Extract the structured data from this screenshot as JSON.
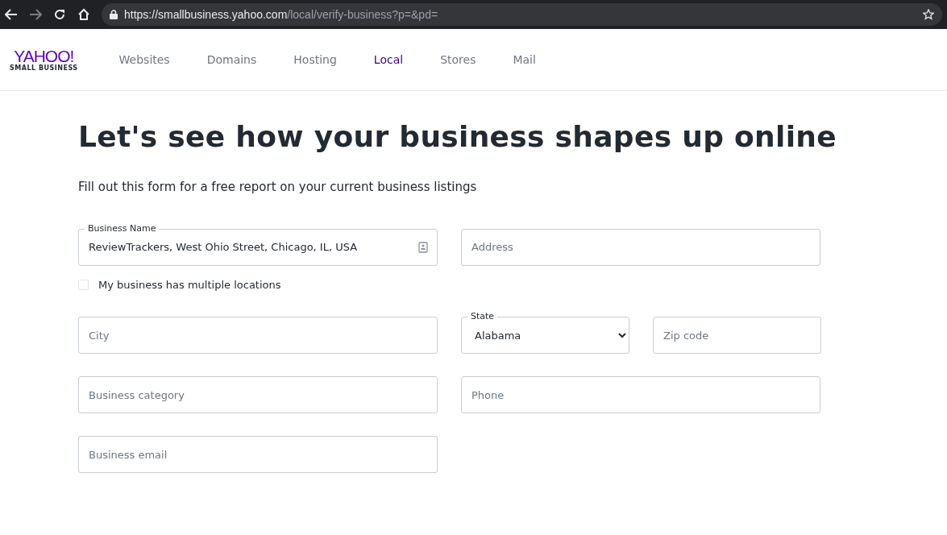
{
  "browser": {
    "url_host": "https://smallbusiness.yahoo.com",
    "url_path": "/local/verify-business?p=&pd="
  },
  "logo": {
    "wordmark": "YAHOO!",
    "tagline": "SMALL BUSINESS"
  },
  "nav": [
    {
      "label": "Websites",
      "selected": false
    },
    {
      "label": "Domains",
      "selected": false
    },
    {
      "label": "Hosting",
      "selected": false
    },
    {
      "label": "Local",
      "selected": true
    },
    {
      "label": "Stores",
      "selected": false
    },
    {
      "label": "Mail",
      "selected": false
    }
  ],
  "heading": "Let's see how your business shapes up online",
  "subtitle": "Fill out this form for a free report on your current business listings",
  "form": {
    "rows": [
      {
        "fields": [
          {
            "kind": "text",
            "label": "Business Name",
            "value": "ReviewTrackers, West Ohio Street, Chicago, IL, USA",
            "contact_icon": true
          },
          {
            "kind": "text",
            "placeholder": "Address"
          }
        ]
      },
      {
        "fields": [
          {
            "kind": "checkbox",
            "label": "My business has multiple locations",
            "checked": false
          }
        ]
      },
      {
        "fields": [
          {
            "kind": "text",
            "placeholder": "City"
          },
          {
            "kind": "select",
            "label": "State",
            "value": "Alabama"
          },
          {
            "kind": "text",
            "placeholder": "Zip code"
          }
        ]
      },
      {
        "fields": [
          {
            "kind": "text",
            "placeholder": "Business category"
          },
          {
            "kind": "text",
            "placeholder": "Phone"
          }
        ]
      },
      {
        "fields": [
          {
            "kind": "text",
            "placeholder": "Business email"
          }
        ]
      }
    ]
  }
}
